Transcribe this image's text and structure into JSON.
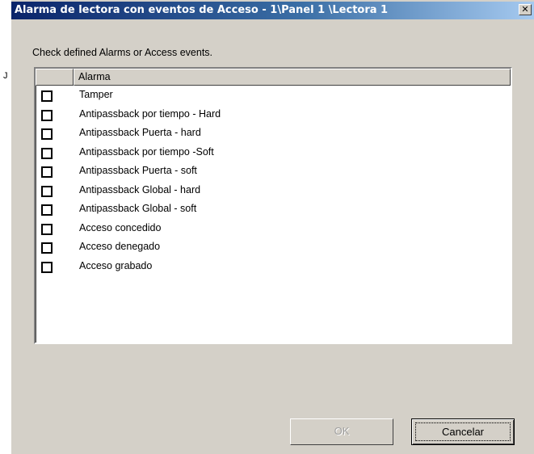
{
  "background_window": {
    "edge_fragments": [
      "J"
    ]
  },
  "dialog": {
    "title": "Alarma de lectora  con eventos de Acceso - 1\\Panel  1 \\Lectora  1",
    "close_glyph": "✕",
    "close_icon": "close-icon",
    "instructions": "Check defined Alarms or Access events.",
    "list": {
      "columns": [
        "",
        "Alarma"
      ],
      "items": [
        {
          "label": "Tamper",
          "checked": false
        },
        {
          "label": "Antipassback por tiempo - Hard",
          "checked": false
        },
        {
          "label": "Antipassback Puerta - hard",
          "checked": false
        },
        {
          "label": "Antipassback por tiempo -Soft",
          "checked": false
        },
        {
          "label": "Antipassback Puerta - soft",
          "checked": false
        },
        {
          "label": "Antipassback Global -  hard",
          "checked": false
        },
        {
          "label": "Antipassback Global - soft",
          "checked": false
        },
        {
          "label": "Acceso concedido",
          "checked": false
        },
        {
          "label": "Acceso denegado",
          "checked": false
        },
        {
          "label": "Acceso grabado",
          "checked": false
        }
      ]
    },
    "buttons": {
      "ok_label": "OK",
      "ok_enabled": false,
      "cancel_label": "Cancelar"
    },
    "colors": {
      "title_gradient_start": "#0a246a",
      "title_gradient_end": "#a6caf0",
      "face": "#d4d0c8"
    }
  }
}
